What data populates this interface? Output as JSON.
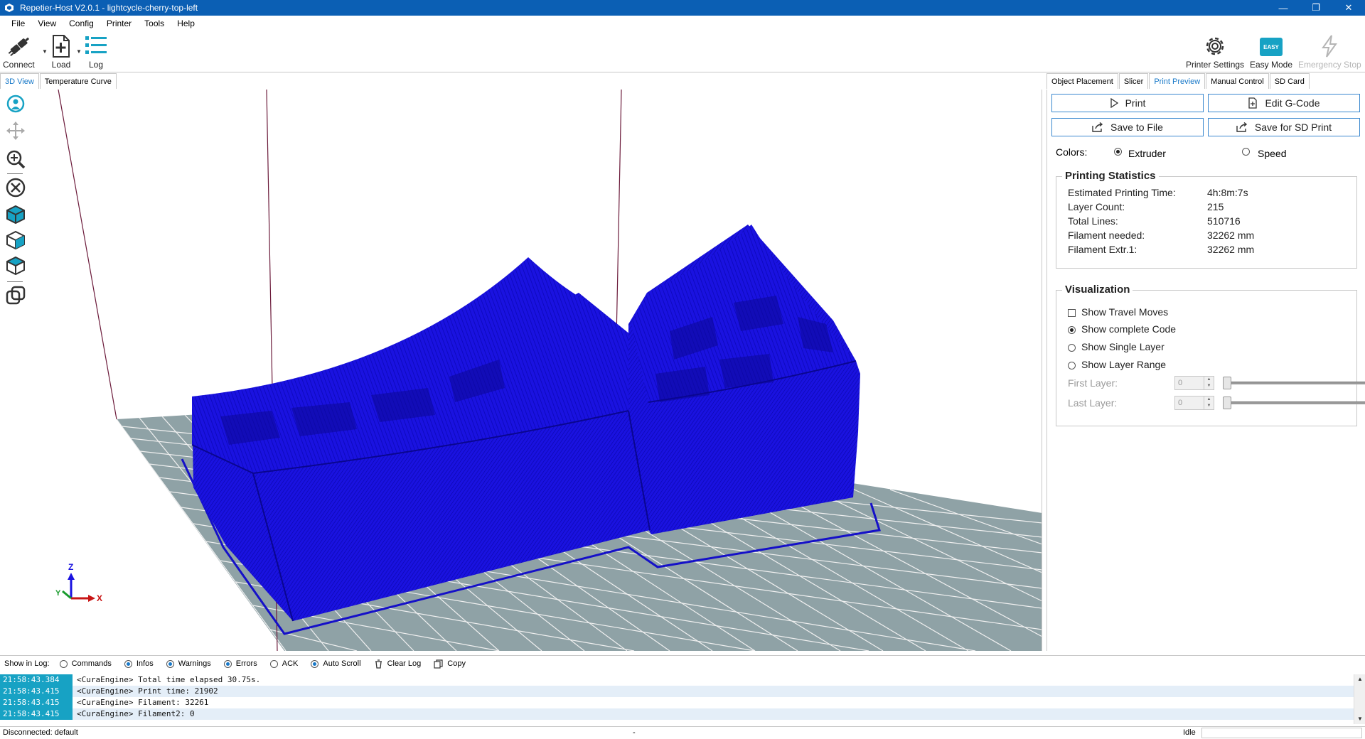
{
  "window": {
    "title": "Repetier-Host V2.0.1 - lightcycle-cherry-top-left",
    "min": "—",
    "max": "❐",
    "close": "✕"
  },
  "menu": [
    "File",
    "View",
    "Config",
    "Printer",
    "Tools",
    "Help"
  ],
  "toolbar": {
    "connect": "Connect",
    "load": "Load",
    "log": "Log",
    "printer_settings": "Printer Settings",
    "easy_mode": "Easy Mode",
    "easy_badge": "EASY",
    "emergency_stop": "Emergency Stop"
  },
  "view_tabs": [
    "3D View",
    "Temperature Curve"
  ],
  "right_tabs": [
    "Object Placement",
    "Slicer",
    "Print Preview",
    "Manual Control",
    "SD Card"
  ],
  "actions": {
    "print": "Print",
    "edit_gcode": "Edit G-Code",
    "save_to_file": "Save to File",
    "save_for_sd": "Save for SD Print"
  },
  "colors": {
    "label": "Colors:",
    "extruder": "Extruder",
    "speed": "Speed",
    "selected": "Extruder"
  },
  "stats": {
    "title": "Printing Statistics",
    "rows": [
      {
        "label": "Estimated Printing Time:",
        "value": "4h:8m:7s"
      },
      {
        "label": "Layer Count:",
        "value": "215"
      },
      {
        "label": "Total Lines:",
        "value": "510716"
      },
      {
        "label": "Filament needed:",
        "value": "32262 mm"
      },
      {
        "label": "Filament Extr.1:",
        "value": "32262 mm"
      }
    ]
  },
  "visualization": {
    "title": "Visualization",
    "show_travel": "Show Travel Moves",
    "show_complete": "Show complete Code",
    "show_single": "Show Single Layer",
    "show_range": "Show Layer Range",
    "first_layer": "First Layer:",
    "last_layer": "Last Layer:",
    "first_value": "0",
    "last_value": "0"
  },
  "axes": {
    "z": "Z",
    "y": "Y",
    "x": "X"
  },
  "log_toolbar": {
    "show_in_log": "Show in Log:",
    "commands": "Commands",
    "infos": "Infos",
    "warnings": "Warnings",
    "errors": "Errors",
    "ack": "ACK",
    "auto_scroll": "Auto Scroll",
    "clear_log": "Clear Log",
    "copy": "Copy"
  },
  "log": [
    {
      "time": "21:58:43.384",
      "msg": "<CuraEngine> Total time elapsed 30.75s."
    },
    {
      "time": "21:58:43.415",
      "msg": "<CuraEngine> Print time: 21902"
    },
    {
      "time": "21:58:43.415",
      "msg": "<CuraEngine> Filament: 32261"
    },
    {
      "time": "21:58:43.415",
      "msg": "<CuraEngine> Filament2: 0"
    }
  ],
  "status": {
    "connection": "Disconnected: default",
    "middle": "-",
    "state": "Idle"
  },
  "colors_theme": {
    "accent": "#1778c8",
    "title_bar": "#0b5fb4",
    "model": "#1a12e0",
    "bed": "#8fa2a6"
  }
}
